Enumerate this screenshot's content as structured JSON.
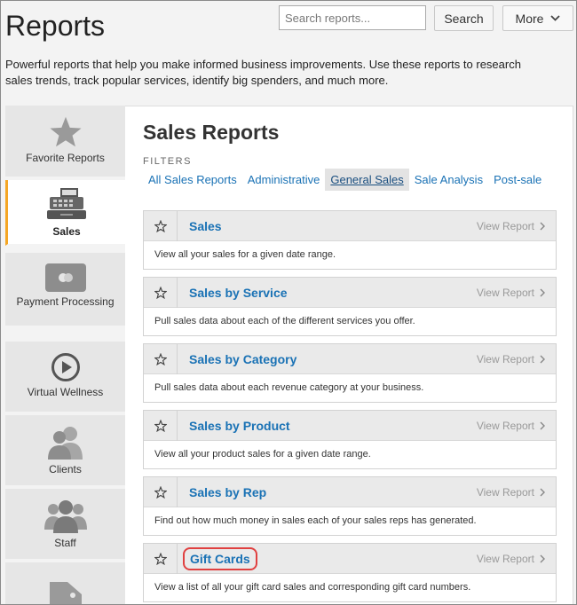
{
  "header": {
    "title": "Reports",
    "search_placeholder": "Search reports...",
    "search_button": "Search",
    "more_button": "More",
    "description": "Powerful reports that help you make informed business improvements. Use these reports to research sales trends, track popular services, identify big spenders, and much more."
  },
  "sidebar": {
    "items": [
      {
        "label": "Favorite Reports",
        "icon": "star-icon"
      },
      {
        "label": "Sales",
        "icon": "cash-register-icon",
        "active": true
      },
      {
        "label": "Payment Processing",
        "icon": "credit-card-icon"
      },
      {
        "label": "Virtual Wellness",
        "icon": "play-circle-icon"
      },
      {
        "label": "Clients",
        "icon": "clients-icon"
      },
      {
        "label": "Staff",
        "icon": "staff-icon"
      },
      {
        "label": "",
        "icon": "tag-icon"
      }
    ]
  },
  "main": {
    "title": "Sales Reports",
    "filters_label": "FILTERS",
    "filters": [
      "All Sales Reports",
      "Administrative",
      "General Sales",
      "Sale Analysis",
      "Post-sale"
    ],
    "active_filter": "General Sales",
    "view_report_label": "View Report",
    "reports": [
      {
        "name": "Sales",
        "description": "View all your sales for a given date range."
      },
      {
        "name": "Sales by Service",
        "description": "Pull sales data about each of the different services you offer."
      },
      {
        "name": "Sales by Category",
        "description": "Pull sales data about each revenue category at your business."
      },
      {
        "name": "Sales by Product",
        "description": "View all your product sales for a given date range."
      },
      {
        "name": "Sales by Rep",
        "description": "Find out how much money in sales each of your sales reps has generated."
      },
      {
        "name": "Gift Cards",
        "description": "View a list of all your gift card sales and corresponding gift card numbers.",
        "highlighted": true
      }
    ]
  },
  "colors": {
    "link": "#1a72b5",
    "active_tab_accent": "#f5a623",
    "highlight_circle": "#e04040"
  }
}
